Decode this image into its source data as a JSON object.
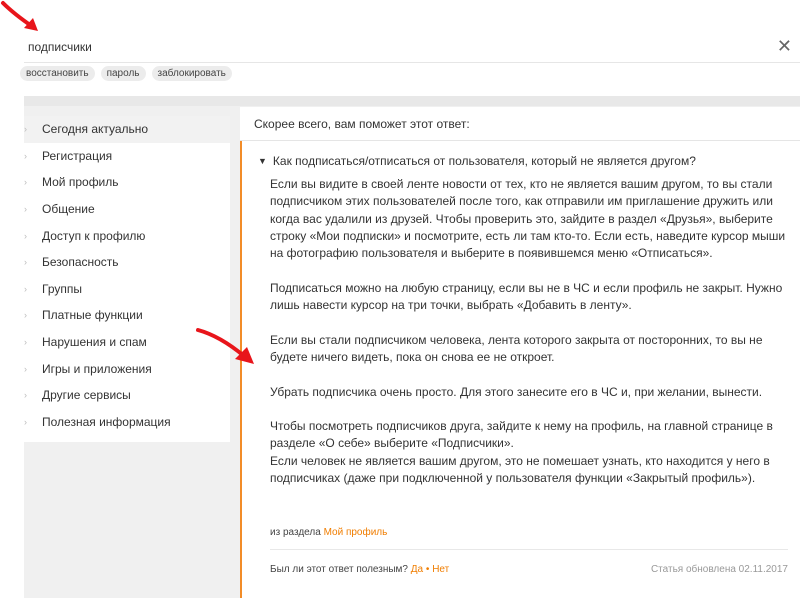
{
  "search": {
    "value": "подписчики",
    "chips": [
      "восстановить",
      "пароль",
      "заблокировать"
    ]
  },
  "sidebar": {
    "items": [
      {
        "label": "Сегодня актуально",
        "active": true
      },
      {
        "label": "Регистрация"
      },
      {
        "label": "Мой профиль"
      },
      {
        "label": "Общение"
      },
      {
        "label": "Доступ к профилю"
      },
      {
        "label": "Безопасность"
      },
      {
        "label": "Группы"
      },
      {
        "label": "Платные функции"
      },
      {
        "label": "Нарушения и спам"
      },
      {
        "label": "Игры и приложения"
      },
      {
        "label": "Другие сервисы"
      },
      {
        "label": "Полезная информация"
      }
    ]
  },
  "content": {
    "header": "Скорее всего, вам поможет этот ответ:",
    "question": "Как подписаться/отписаться от пользователя, который не является другом?",
    "paragraphs": [
      "Если вы видите в своей ленте новости от тех, кто не является вашим другом, то вы стали подписчиком этих пользователей после того, как отправили им приглашение дружить или когда вас удалили из друзей. Чтобы проверить это, зайдите в раздел «Друзья», выберите строку «Мои подписки» и посмотрите, есть ли там кто-то. Если есть, наведите курсор мыши на фотографию пользователя и выберите в появившемся меню «Отписаться».",
      "Подписаться можно на любую страницу, если вы не в ЧС и если профиль не закрыт. Нужно лишь навести курсор на три точки, выбрать «Добавить в ленту».",
      "Если вы стали подписчиком человека, лента которого закрыта от посторонних, то вы не будете ничего видеть, пока он снова ее не откроет.",
      "Убрать подписчика очень просто. Для этого занесите его в ЧС и, при желании, вынести.",
      "Чтобы посмотреть подписчиков друга, зайдите к нему на профиль, на главной странице в разделе «О себе» выберите «Подписчики».",
      "Если человек не является вашим другом, это не помешает узнать, кто находится у него в подписчиках (даже при подключенной у пользователя функции «Закрытый профиль»)."
    ],
    "section_prefix": "из раздела",
    "section_link": "Мой профиль",
    "feedback_question": "Был ли этот ответ полезным?",
    "yes": "Да",
    "separator": "•",
    "no": "Нет",
    "updated": "Статья обновлена 02.11.2017"
  },
  "colors": {
    "accent": "#f07d00",
    "article_border": "#f28c28",
    "annotation_arrow": "#e8151b"
  }
}
